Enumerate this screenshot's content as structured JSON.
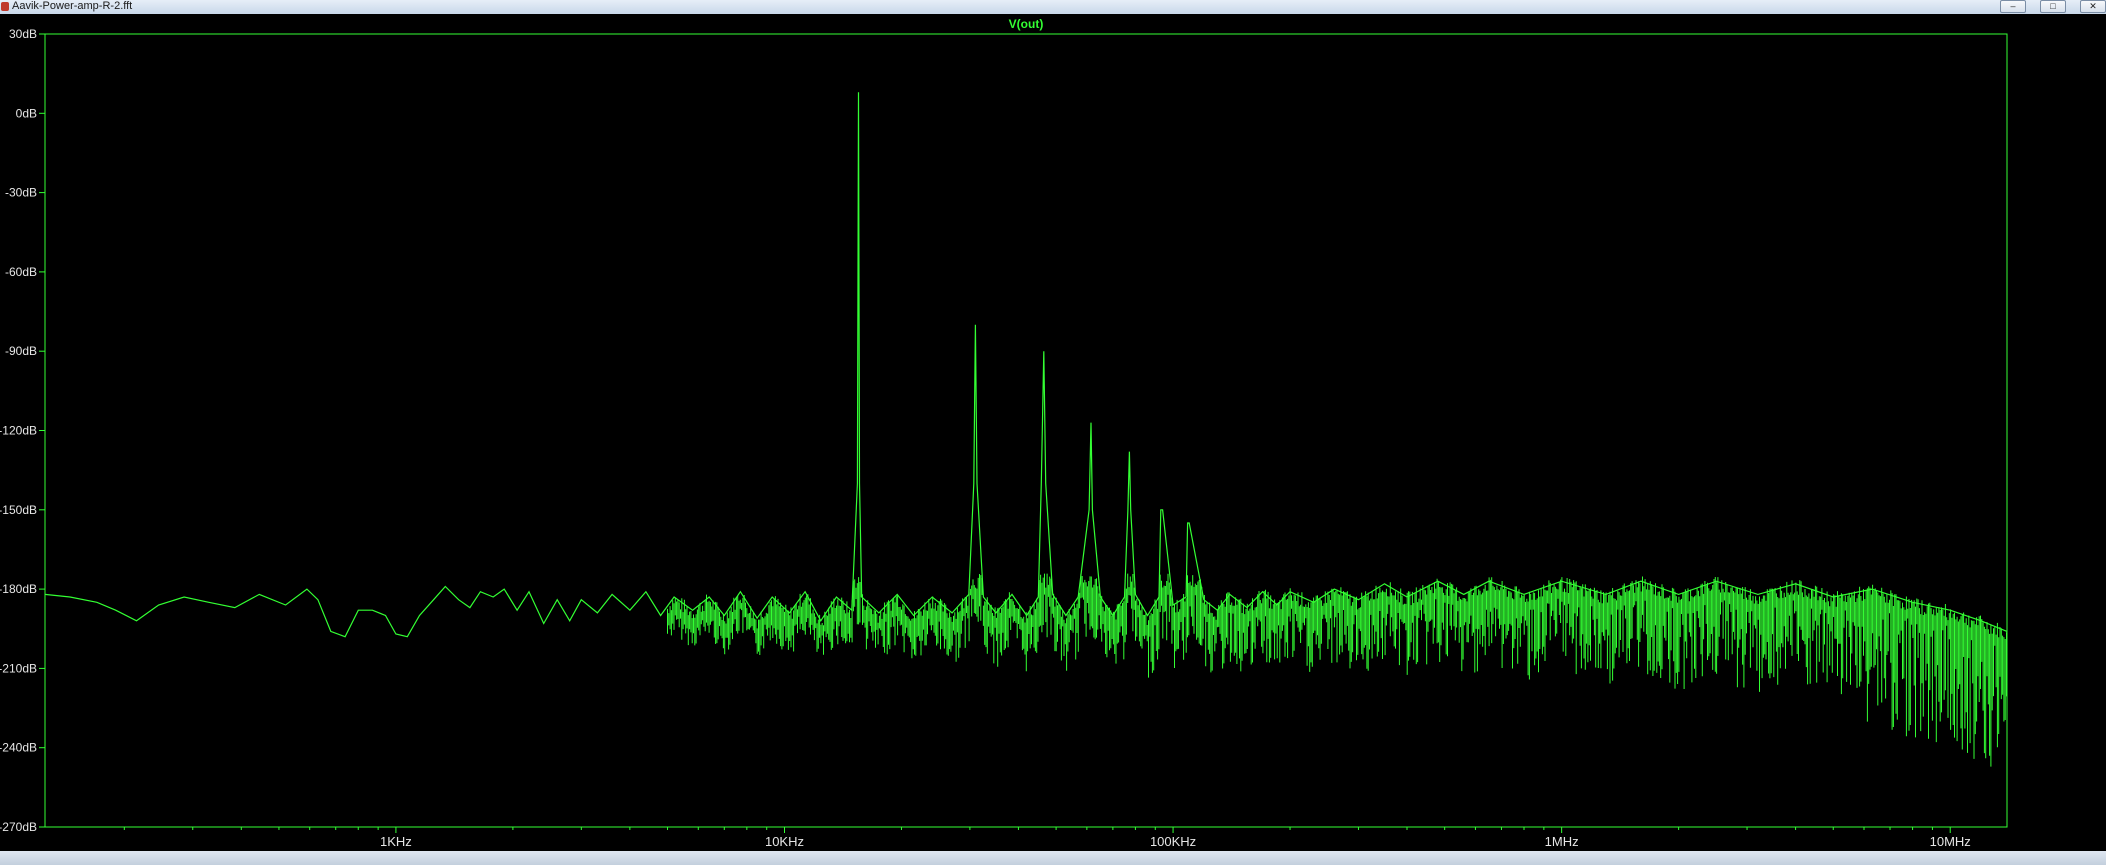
{
  "window": {
    "title": "Aavik-Power-amp-R-2.fft",
    "minimize_label": "–",
    "maximize_label": "□",
    "close_label": "✕"
  },
  "colors": {
    "trace": "#33ff33",
    "axes": "#33ff33",
    "labels": "#e6e6e6",
    "background": "#000000"
  },
  "chart_data": {
    "type": "line",
    "title": "V(out)",
    "xscale": "log",
    "xlim": [
      125,
      14000000
    ],
    "ylim": [
      -270,
      30
    ],
    "grid": false,
    "x_ticks": [
      {
        "value": 1000,
        "label": "1KHz"
      },
      {
        "value": 10000,
        "label": "10KHz"
      },
      {
        "value": 100000,
        "label": "100KHz"
      },
      {
        "value": 1000000,
        "label": "1MHz"
      },
      {
        "value": 10000000,
        "label": "10MHz"
      }
    ],
    "y_ticks": [
      {
        "value": 30,
        "label": "30dB"
      },
      {
        "value": 0,
        "label": "0dB"
      },
      {
        "value": -30,
        "label": "-30dB"
      },
      {
        "value": -60,
        "label": "-60dB"
      },
      {
        "value": -90,
        "label": "-90dB"
      },
      {
        "value": -120,
        "label": "-120dB"
      },
      {
        "value": -150,
        "label": "-150dB"
      },
      {
        "value": -180,
        "label": "-180dB"
      },
      {
        "value": -210,
        "label": "-210dB"
      },
      {
        "value": -240,
        "label": "-240dB"
      },
      {
        "value": -270,
        "label": "-270dB"
      }
    ],
    "series": [
      {
        "points": [
          [
            125,
            -182
          ],
          [
            145,
            -183
          ],
          [
            170,
            -185
          ],
          [
            190,
            -188
          ],
          [
            215,
            -192
          ],
          [
            245,
            -186
          ],
          [
            285,
            -183
          ],
          [
            330,
            -185
          ],
          [
            385,
            -187
          ],
          [
            445,
            -182
          ],
          [
            520,
            -186
          ],
          [
            590,
            -180
          ],
          [
            630,
            -184
          ],
          [
            680,
            -196
          ],
          [
            740,
            -198
          ],
          [
            800,
            -188
          ],
          [
            870,
            -188
          ],
          [
            940,
            -190
          ],
          [
            1000,
            -197
          ],
          [
            1070,
            -198
          ],
          [
            1150,
            -190
          ],
          [
            1250,
            -184
          ],
          [
            1340,
            -179
          ],
          [
            1450,
            -184
          ],
          [
            1550,
            -187
          ],
          [
            1650,
            -181
          ],
          [
            1780,
            -183
          ],
          [
            1900,
            -180
          ],
          [
            2050,
            -188
          ],
          [
            2200,
            -181
          ],
          [
            2400,
            -193
          ],
          [
            2600,
            -184
          ],
          [
            2800,
            -192
          ],
          [
            3000,
            -184
          ],
          [
            3300,
            -189
          ],
          [
            3600,
            -182
          ],
          [
            4000,
            -188
          ],
          [
            4400,
            -181
          ],
          [
            4800,
            -190
          ],
          [
            5200,
            -183
          ],
          [
            5800,
            -188
          ],
          [
            6400,
            -183
          ],
          [
            7000,
            -190
          ],
          [
            7700,
            -181
          ],
          [
            8500,
            -191
          ],
          [
            9300,
            -183
          ],
          [
            10300,
            -189
          ],
          [
            11300,
            -181
          ],
          [
            12400,
            -192
          ],
          [
            13600,
            -183
          ],
          [
            14900,
            -188
          ],
          [
            15400,
            -140
          ],
          [
            15500,
            8
          ],
          [
            15600,
            -140
          ],
          [
            15800,
            -183
          ],
          [
            17500,
            -189
          ],
          [
            19500,
            -182
          ],
          [
            21500,
            -190
          ],
          [
            24000,
            -183
          ],
          [
            27000,
            -189
          ],
          [
            29800,
            -182
          ],
          [
            30700,
            -140
          ],
          [
            31000,
            -80
          ],
          [
            31300,
            -140
          ],
          [
            32500,
            -183
          ],
          [
            35000,
            -189
          ],
          [
            38500,
            -182
          ],
          [
            42000,
            -190
          ],
          [
            45000,
            -183
          ],
          [
            45800,
            -140
          ],
          [
            46500,
            -90
          ],
          [
            47000,
            -140
          ],
          [
            49000,
            -182
          ],
          [
            53000,
            -190
          ],
          [
            57000,
            -183
          ],
          [
            60800,
            -150
          ],
          [
            61500,
            -117
          ],
          [
            62000,
            -150
          ],
          [
            65000,
            -183
          ],
          [
            70000,
            -190
          ],
          [
            75000,
            -183
          ],
          [
            76500,
            -150
          ],
          [
            77200,
            -128
          ],
          [
            77800,
            -150
          ],
          [
            80000,
            -182
          ],
          [
            86000,
            -190
          ],
          [
            92000,
            -183
          ],
          [
            93000,
            -150
          ],
          [
            93500,
            -150
          ],
          [
            94000,
            -150
          ],
          [
            100000,
            -186
          ],
          [
            108000,
            -183
          ],
          [
            109000,
            -155
          ],
          [
            109500,
            -155
          ],
          [
            110000,
            -155
          ],
          [
            120000,
            -184
          ],
          [
            130000,
            -188
          ],
          [
            140000,
            -182
          ],
          [
            155000,
            -187
          ],
          [
            170000,
            -181
          ],
          [
            185000,
            -186
          ],
          [
            200000,
            -181
          ],
          [
            230000,
            -185
          ],
          [
            260000,
            -180
          ],
          [
            300000,
            -184
          ],
          [
            350000,
            -178
          ],
          [
            400000,
            -183
          ],
          [
            480000,
            -177
          ],
          [
            560000,
            -182
          ],
          [
            650000,
            -177
          ],
          [
            800000,
            -182
          ],
          [
            1000000,
            -177
          ],
          [
            1300000,
            -182
          ],
          [
            1600000,
            -177
          ],
          [
            2000000,
            -182
          ],
          [
            2500000,
            -177
          ],
          [
            3200000,
            -182
          ],
          [
            4000000,
            -178
          ],
          [
            5000000,
            -183
          ],
          [
            6300000,
            -180
          ],
          [
            8000000,
            -185
          ],
          [
            10000000,
            -188
          ],
          [
            12000000,
            -192
          ],
          [
            14000000,
            -196
          ]
        ]
      }
    ]
  }
}
